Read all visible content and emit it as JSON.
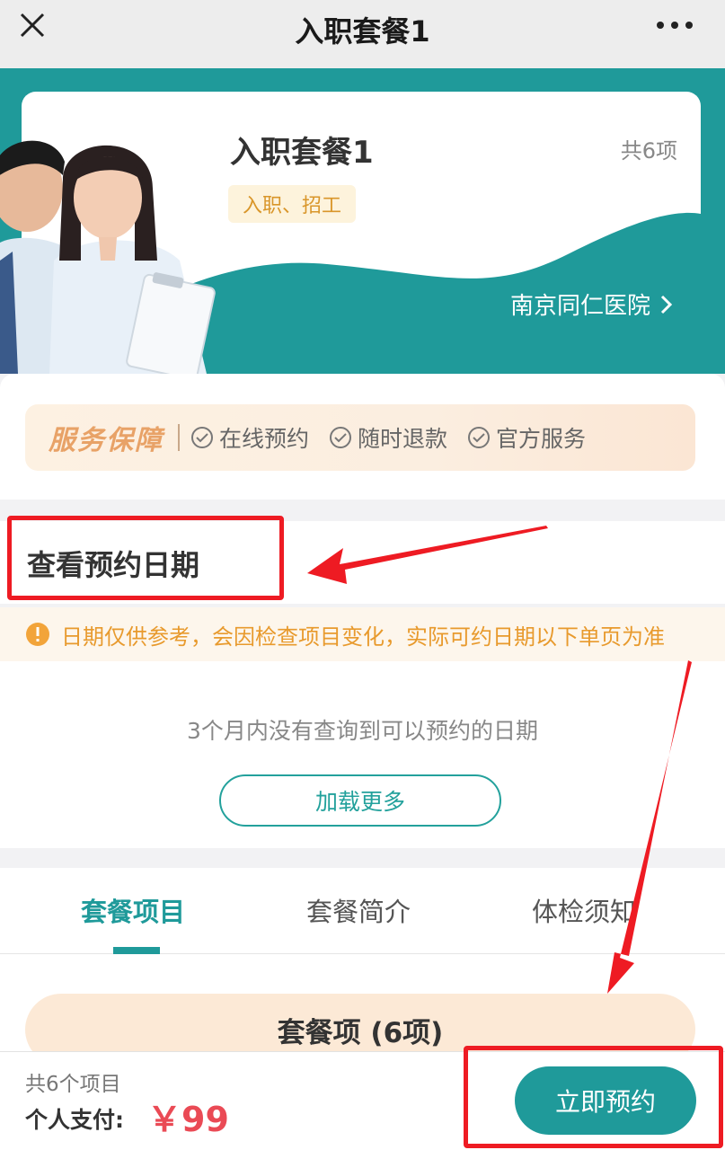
{
  "topbar": {
    "title": "入职套餐1",
    "close_icon": "close-icon",
    "more_icon": "more-dots-icon"
  },
  "package": {
    "title": "入职套餐1",
    "count": "共6项",
    "tag": "入职、招工",
    "hospital": "南京同仁医院",
    "hospital_icon": "chevron-right-icon"
  },
  "service": {
    "brand": "服务保障",
    "items": [
      "在线预约",
      "随时退款",
      "官方服务"
    ]
  },
  "date_section": {
    "heading": "查看预约日期",
    "notice": "日期仅供参考，会因检查项目变化，实际可约日期以下单页为准",
    "empty_message": "3个月内没有查询到可以预约的日期",
    "load_more": "加载更多"
  },
  "tabs": [
    {
      "label": "套餐项目",
      "active": true
    },
    {
      "label": "套餐简介",
      "active": false
    },
    {
      "label": "体检须知",
      "active": false
    }
  ],
  "items_header": "套餐项 (6项)",
  "bottom": {
    "total_items": "共6个项目",
    "pay_label": "个人支付:",
    "price": "￥99",
    "book_button": "立即预约"
  },
  "colors": {
    "brand_teal": "#1f9a9a",
    "highlight_red": "#ee1b23",
    "price_red": "#ea4a55",
    "notice_orange": "#e89a2d"
  }
}
